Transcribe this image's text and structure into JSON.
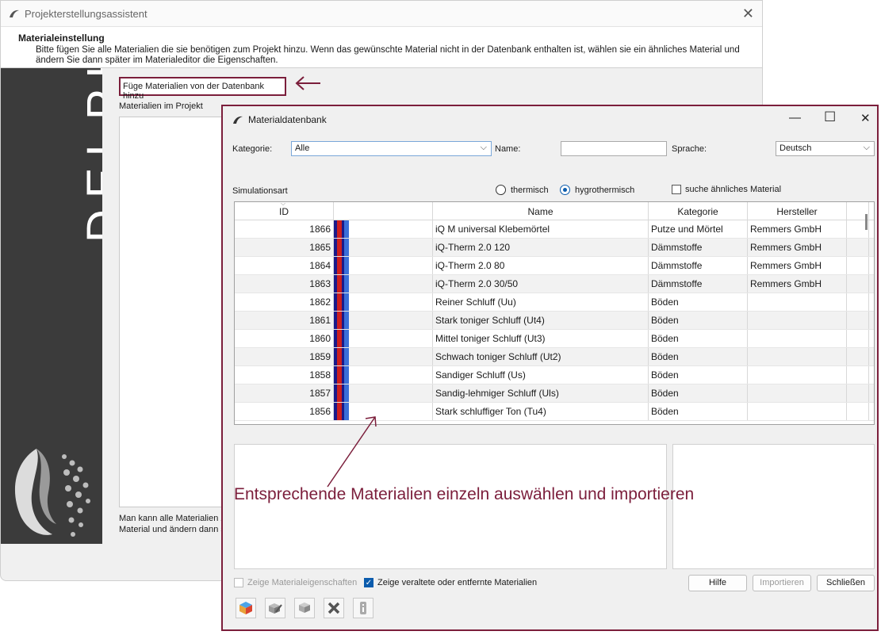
{
  "wizard": {
    "title": "Projekterstellungsassistent",
    "heading": "Materialeinstellung",
    "description": "Bitte fügen Sie alle Materialien die sie benötigen zum Projekt hinzu. Wenn das gewünschte Material nicht in der Datenbank enthalten ist, wählen sie ein ähnliches Material und ändern Sie dann später im Materialeditor die Eigenschaften.",
    "brand": "DELPHIN",
    "add_button": "Füge Materialien von der Datenbank hinzu",
    "project_materials_label": "Materialien im Projekt",
    "note_line1": "Man kann alle Materialien z",
    "note_line2": "Material und ändern dann s"
  },
  "dialog": {
    "title": "Materialdatenbank",
    "category_label": "Kategorie:",
    "category_value": "Alle",
    "name_label": "Name:",
    "name_value": "",
    "language_label": "Sprache:",
    "language_value": "Deutsch",
    "simulation_label": "Simulationsart",
    "radio_thermal": "thermisch",
    "radio_hygro": "hygrothermisch",
    "similar_label": "suche ähnliches Material",
    "columns": [
      "ID",
      "",
      "Name",
      "Kategorie",
      "Hersteller"
    ],
    "rows": [
      {
        "id": "1866",
        "name": "iQ M universal Klebemörtel",
        "kategorie": "Putze und Mörtel",
        "hersteller": "Remmers GmbH"
      },
      {
        "id": "1865",
        "name": "iQ-Therm 2.0 120",
        "kategorie": "Dämmstoffe",
        "hersteller": "Remmers GmbH"
      },
      {
        "id": "1864",
        "name": "iQ-Therm 2.0 80",
        "kategorie": "Dämmstoffe",
        "hersteller": "Remmers GmbH"
      },
      {
        "id": "1863",
        "name": "iQ-Therm 2.0 30/50",
        "kategorie": "Dämmstoffe",
        "hersteller": "Remmers GmbH"
      },
      {
        "id": "1862",
        "name": "Reiner Schluff (Uu)",
        "kategorie": "Böden",
        "hersteller": ""
      },
      {
        "id": "1861",
        "name": "Stark toniger Schluff (Ut4)",
        "kategorie": "Böden",
        "hersteller": ""
      },
      {
        "id": "1860",
        "name": "Mittel toniger Schluff (Ut3)",
        "kategorie": "Böden",
        "hersteller": ""
      },
      {
        "id": "1859",
        "name": "Schwach toniger Schluff (Ut2)",
        "kategorie": "Böden",
        "hersteller": ""
      },
      {
        "id": "1858",
        "name": "Sandiger Schluff (Us)",
        "kategorie": "Böden",
        "hersteller": ""
      },
      {
        "id": "1857",
        "name": "Sandig-lehmiger Schluff (Uls)",
        "kategorie": "Böden",
        "hersteller": ""
      },
      {
        "id": "1856",
        "name": "Stark schluffiger Ton (Tu4)",
        "kategorie": "Böden",
        "hersteller": ""
      }
    ],
    "annotation": "Entsprechende Materialien einzeln auswählen und importieren",
    "show_props_label": "Zeige Materialeigenschaften",
    "show_obsolete_label": "Zeige veraltete oder entfernte Materialien",
    "help_button": "Hilfe",
    "import_button": "Importieren",
    "close_button": "Schließen"
  },
  "colors": {
    "accent": "#7b1e3b",
    "sidebar": "#3b3b3b",
    "swatch_red": "#cc1f1f",
    "swatch_dark": "#1a1a8a",
    "swatch_blue": "#3a6fd8",
    "checkbox_blue": "#0b5cad"
  }
}
